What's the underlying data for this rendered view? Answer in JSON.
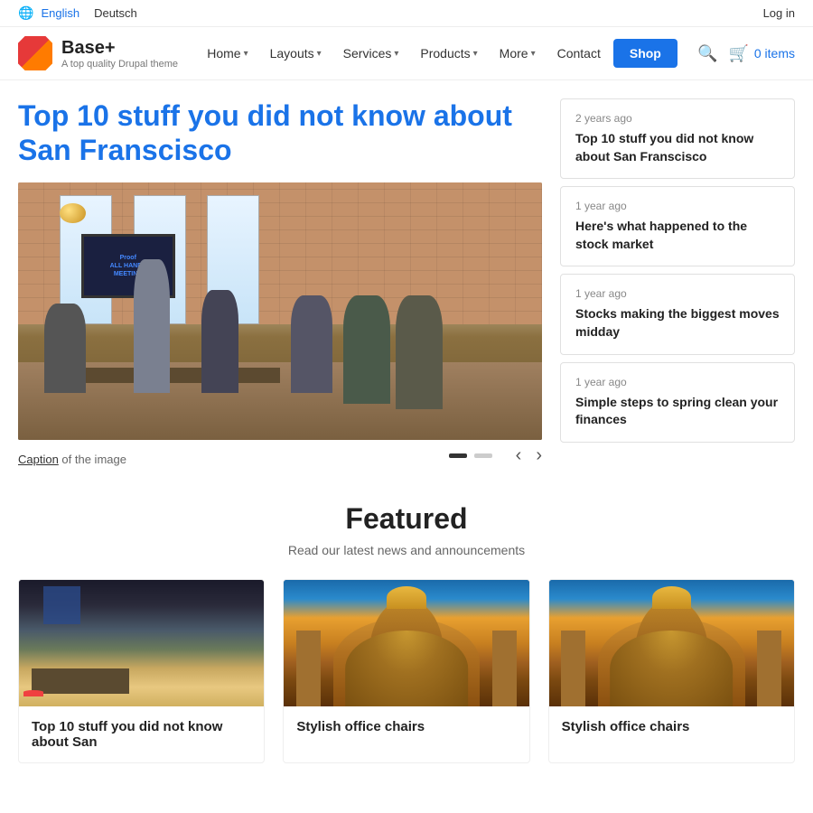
{
  "topbar": {
    "globe_icon": "🌐",
    "lang_active": "English",
    "lang_inactive": "Deutsch",
    "login_label": "Log in"
  },
  "header": {
    "logo_name": "Base+",
    "logo_sub": "A top quality Drupal theme",
    "nav": [
      {
        "label": "Home",
        "has_dropdown": true
      },
      {
        "label": "Layouts",
        "has_dropdown": true
      },
      {
        "label": "Services",
        "has_dropdown": true
      },
      {
        "label": "Products",
        "has_dropdown": true
      },
      {
        "label": "More",
        "has_dropdown": true
      },
      {
        "label": "Contact",
        "has_dropdown": false
      }
    ],
    "shop_label": "Shop",
    "cart_count": "0 items"
  },
  "hero": {
    "title": "Top 10 stuff you did not know about San Franscisco",
    "caption_link": "Caption",
    "caption_text": " of the image",
    "monitor_text": "Proof\nALL HANDS\nMEETING"
  },
  "news_sidebar": {
    "articles": [
      {
        "time": "2 years ago",
        "title": "Top 10 stuff you did not know about San Franscisco"
      },
      {
        "time": "1 year ago",
        "title": "Here's what happened to the stock market"
      },
      {
        "time": "1 year ago",
        "title": "Stocks making the biggest moves midday"
      },
      {
        "time": "1 year ago",
        "title": "Simple steps to spring clean your finances"
      }
    ]
  },
  "featured": {
    "title": "Featured",
    "subtitle": "Read our latest news and announcements",
    "cards": [
      {
        "image_type": "office",
        "title": "Top 10 stuff you did not know about San"
      },
      {
        "image_type": "temple",
        "title": "Stylish office chairs"
      },
      {
        "image_type": "temple",
        "title": "Stylish office chairs"
      }
    ]
  }
}
